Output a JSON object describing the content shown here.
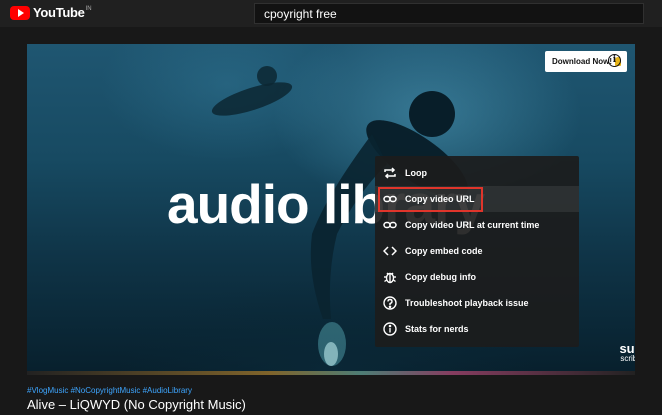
{
  "header": {
    "logo_text": "YouTube",
    "logo_country": "IN",
    "search_value": "cpoyright free"
  },
  "player": {
    "overlay_text": "audio library",
    "download_button": "Download Now!",
    "subscribe_line1": "sub",
    "subscribe_line2": "scribe",
    "accent_color": "#e0352b"
  },
  "context_menu": {
    "items": [
      {
        "label": "Loop",
        "icon": "loop-icon"
      },
      {
        "label": "Copy video URL",
        "icon": "link-icon"
      },
      {
        "label": "Copy video URL at current time",
        "icon": "link-icon"
      },
      {
        "label": "Copy embed code",
        "icon": "code-icon"
      },
      {
        "label": "Copy debug info",
        "icon": "bug-icon"
      },
      {
        "label": "Troubleshoot playback issue",
        "icon": "help-circle-icon"
      },
      {
        "label": "Stats for nerds",
        "icon": "info-icon"
      }
    ],
    "highlighted_label": "Copy video URL"
  },
  "video": {
    "hashtags": "#VlogMusic #NoCopyrightMusic #AudioLibrary",
    "title": "Alive – LiQWYD (No Copyright Music)"
  }
}
